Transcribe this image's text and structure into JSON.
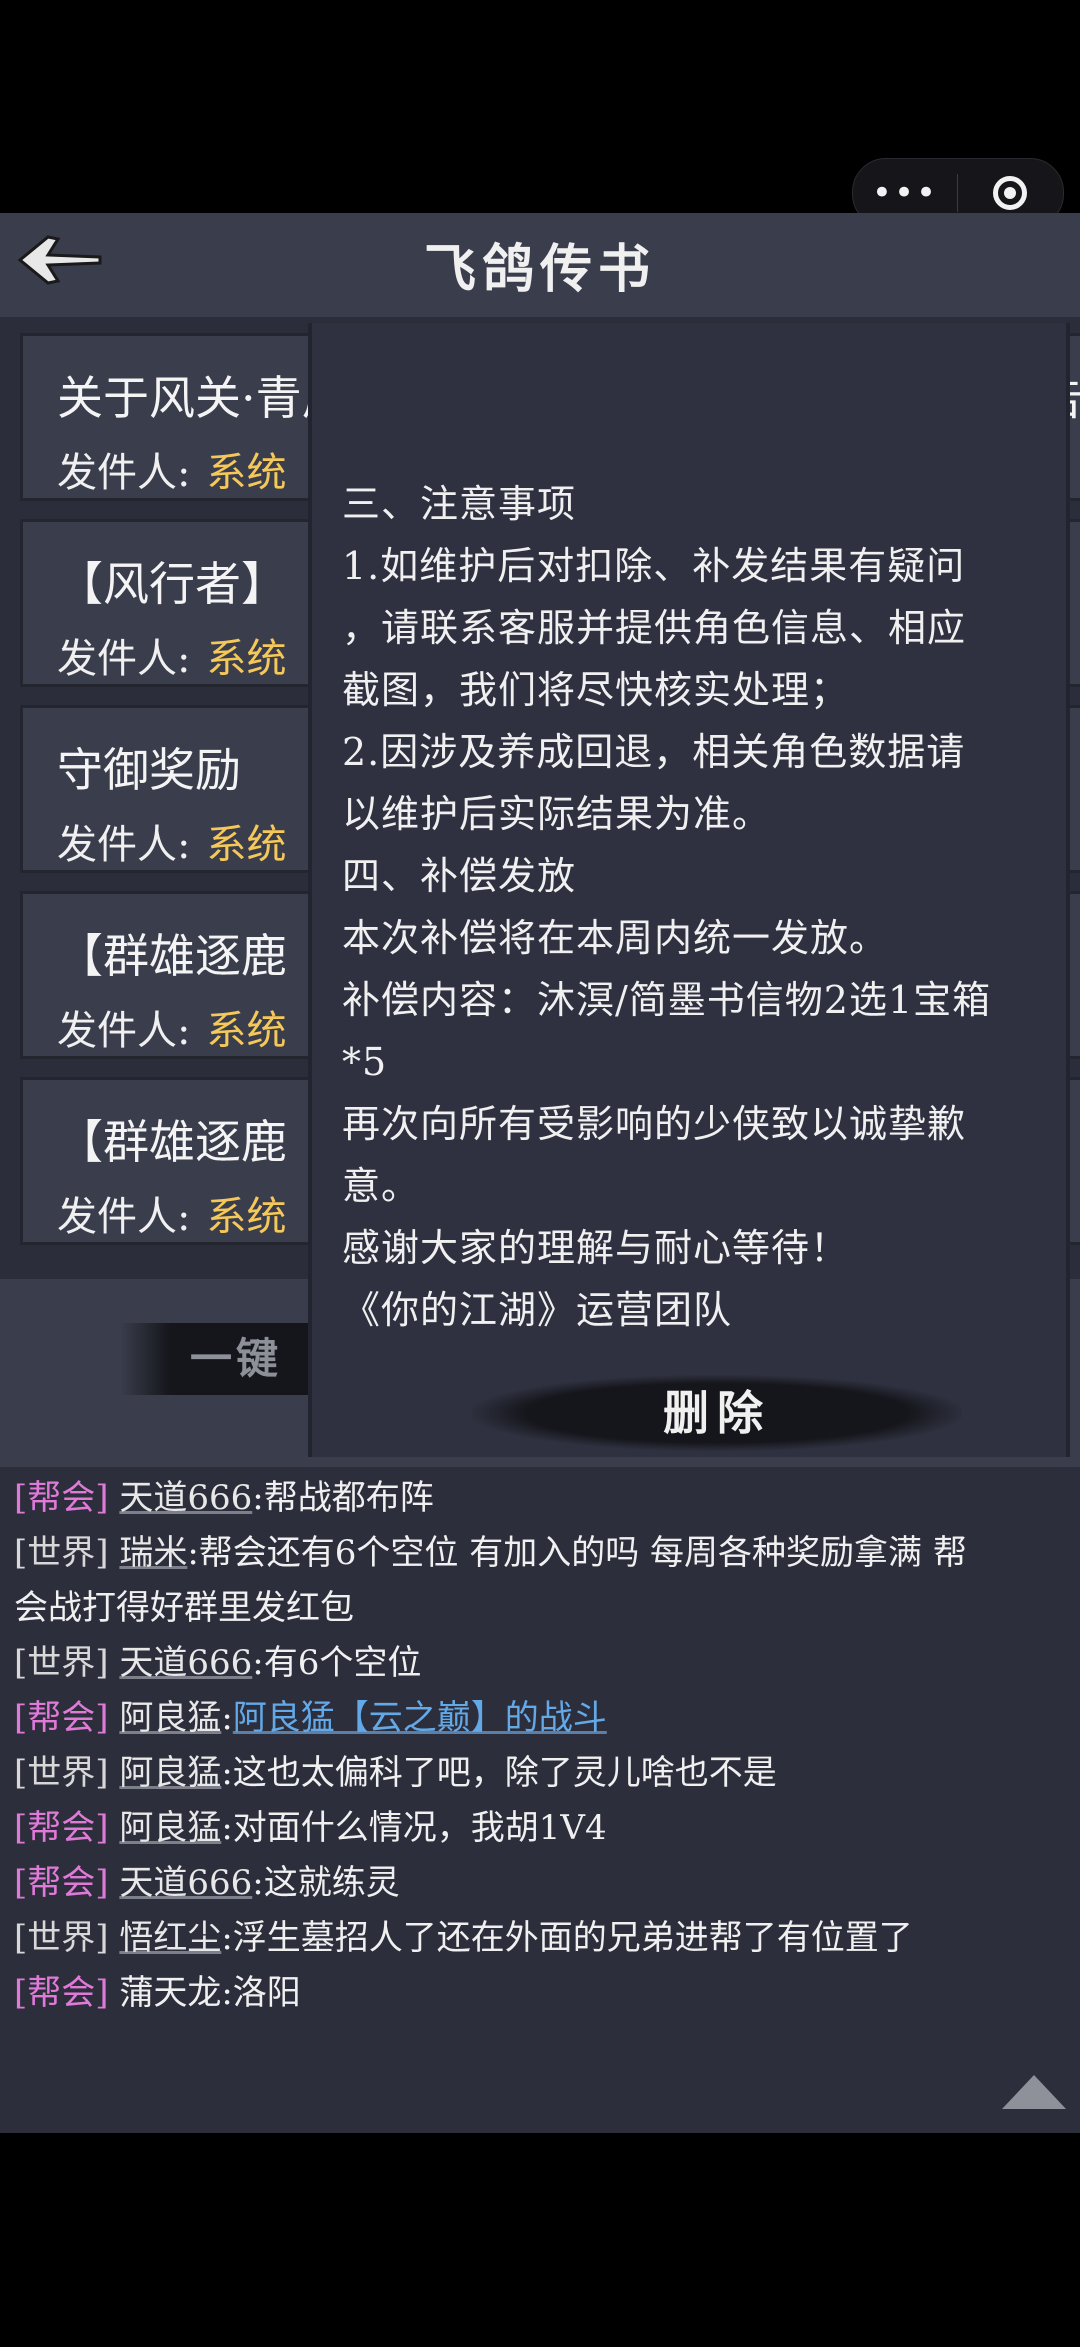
{
  "window": {
    "more_label": "•••"
  },
  "header": {
    "title": "飞鸽传书"
  },
  "mails": [
    {
      "title": "关于风关·青风行者奖励错发问题的致歉与处理公告",
      "sender_label": "发件人:",
      "sender": "系统"
    },
    {
      "title": "【风行者】",
      "sender_label": "发件人:",
      "sender": "系统"
    },
    {
      "title": "守御奖励",
      "sender_label": "发件人:",
      "sender": "系统"
    },
    {
      "title": "【群雄逐鹿",
      "sender_label": "发件人:",
      "sender": "系统"
    },
    {
      "title": "【群雄逐鹿",
      "sender_label": "发件人:",
      "sender": "系统"
    }
  ],
  "one_key_button": "一键",
  "popup": {
    "lines": [
      "三、注意事项",
      "1.如维护后对扣除、补发结果有疑问",
      "，请联系客服并提供角色信息、相应",
      "截图，我们将尽快核实处理；",
      "2.因涉及养成回退，相关角色数据请",
      "以维护后实际结果为准。",
      "四、补偿发放",
      "本次补偿将在本周内统一发放。",
      "补偿内容：沐溟/简墨书信物2选1宝箱",
      "*5",
      "再次向所有受影响的少侠致以诚挚歉",
      "意。",
      "感谢大家的理解与耐心等待！",
      "《你的江湖》运营团队"
    ],
    "delete_label": "删除"
  },
  "chat": [
    {
      "channel": "[帮会]",
      "name": "天道666",
      "text": ":帮战都布阵"
    },
    {
      "channel": "[世界]",
      "name": "瑞米",
      "text": ":帮会还有6个空位 有加入的吗 每周各种奖励拿满 帮"
    },
    {
      "channel": "",
      "name": "",
      "text": "会战打得好群里发红包"
    },
    {
      "channel": "[世界]",
      "name": "天道666",
      "text": ":有6个空位"
    },
    {
      "channel": "[帮会]",
      "name": "阿良猛",
      "text": ":",
      "link": "阿良猛【云之巅】的战斗"
    },
    {
      "channel": "[世界]",
      "name": "阿良猛",
      "text": ":这也太偏科了吧，除了灵儿啥也不是"
    },
    {
      "channel": "[帮会]",
      "name": "阿良猛",
      "text": ":对面什么情况，我胡1V4"
    },
    {
      "channel": "[帮会]",
      "name": "天道666",
      "text": ":这就练灵"
    },
    {
      "channel": "[世界]",
      "name": "悟红尘",
      "text": ":浮生墓招人了还在外面的兄弟进帮了有位置了"
    },
    {
      "channel": "[帮会]",
      "name": "蒲天龙",
      "text": ":洛阳"
    }
  ],
  "colors": {
    "guild_channel": "#e07ad8",
    "sender_system": "#f5c85a",
    "battle_link": "#63a9e8"
  }
}
